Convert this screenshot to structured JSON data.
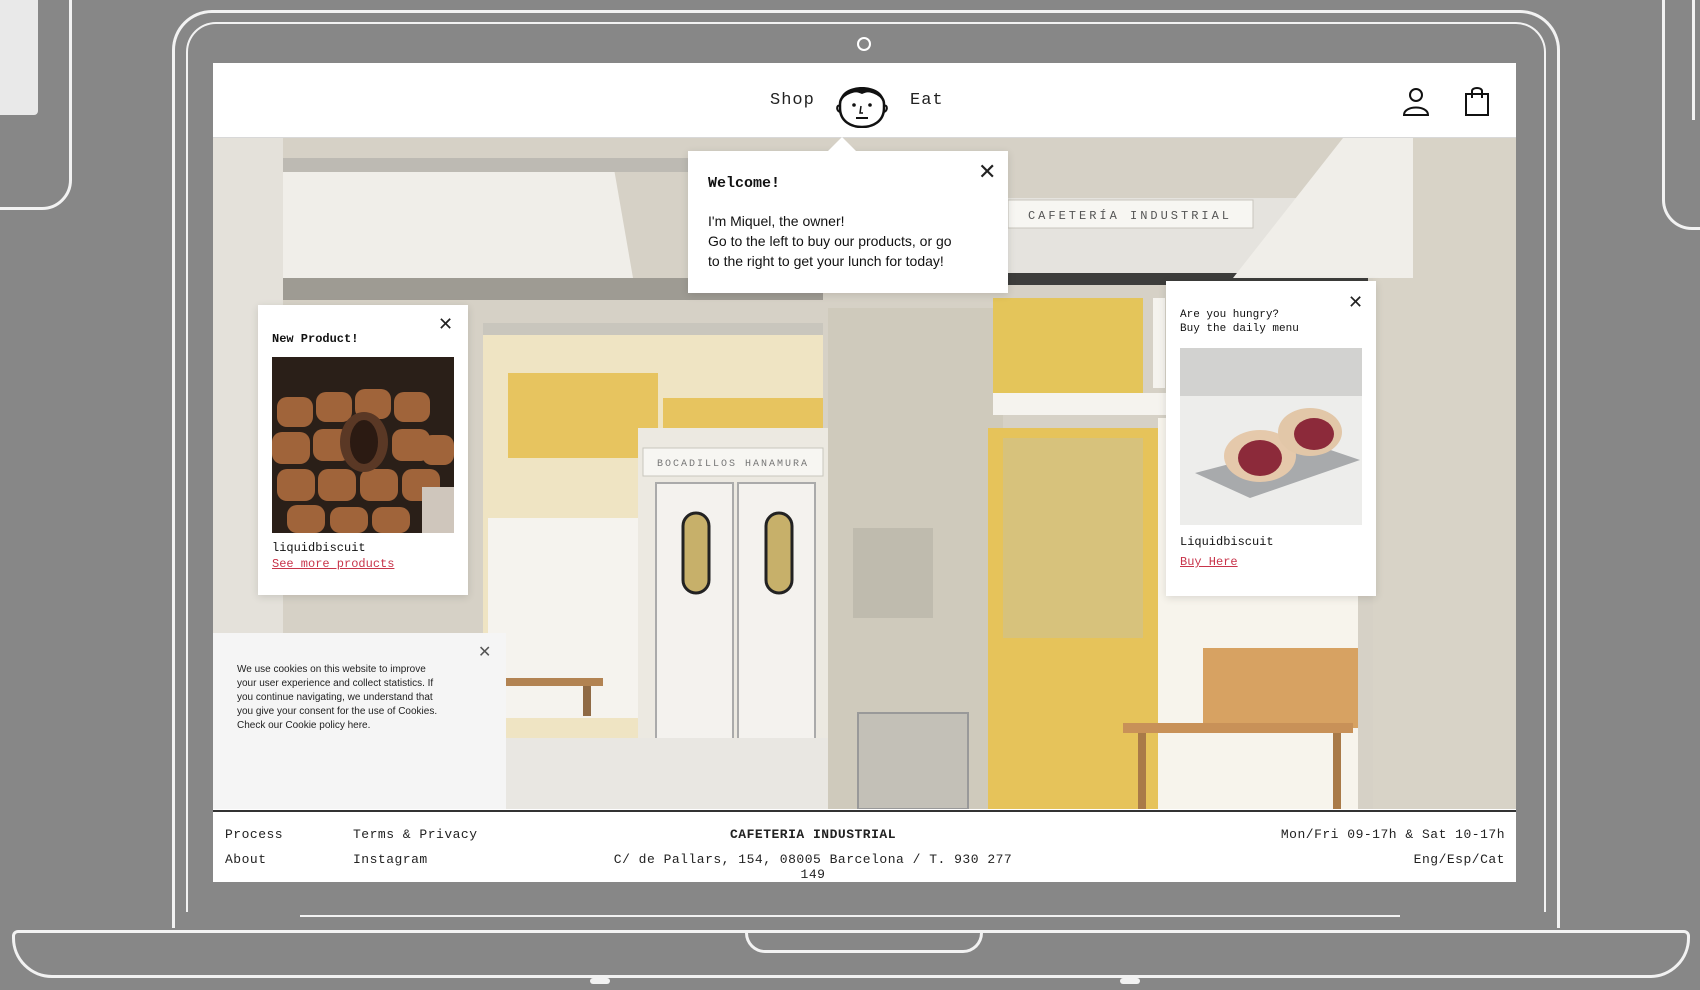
{
  "nav": {
    "shop_label": "Shop",
    "eat_label": "Eat",
    "icons": [
      "user-icon",
      "shopping-bag-icon"
    ]
  },
  "welcome_popup": {
    "title": "Welcome!",
    "line1": "I'm Miquel, the owner!",
    "line2": "Go to the left to buy our products, or go",
    "line3": "to the right to get your lunch for today!"
  },
  "product_popup": {
    "title": "New Product!",
    "name": "liquidbiscuit",
    "link": "See more products"
  },
  "menu_popup": {
    "title_line1": "Are you hungry?",
    "title_line2": "Buy the daily menu",
    "name": "Liquidbiscuit",
    "link": "Buy Here"
  },
  "cookie_popup": {
    "line1": "We use cookies on this website to improve",
    "line2": "your user experience and collect statistics. If",
    "line3": "you continue navigating, we understand that",
    "line4": "you give your consent for the use of Cookies.",
    "line5": "Check our Cookie policy here."
  },
  "hero_signs": {
    "right_sign": "CAFETERÍA  INDUSTRIAL",
    "center_sign": "BOCADILLOS HANAMURA"
  },
  "footer": {
    "process": "Process",
    "about": "About",
    "terms": "Terms & Privacy",
    "instagram": "Instagram",
    "brand": "CAFETERIA INDUSTRIAL",
    "address": "C/ de Pallars, 154, 08005 Barcelona / T. 930 277 149",
    "hours": "Mon/Fri 09-17h & Sat 10-17h",
    "languages": "Eng/Esp/Cat"
  },
  "colors": {
    "background": "#878787",
    "link_red": "#c8344a",
    "wall_yellow": "#e3c35a"
  }
}
